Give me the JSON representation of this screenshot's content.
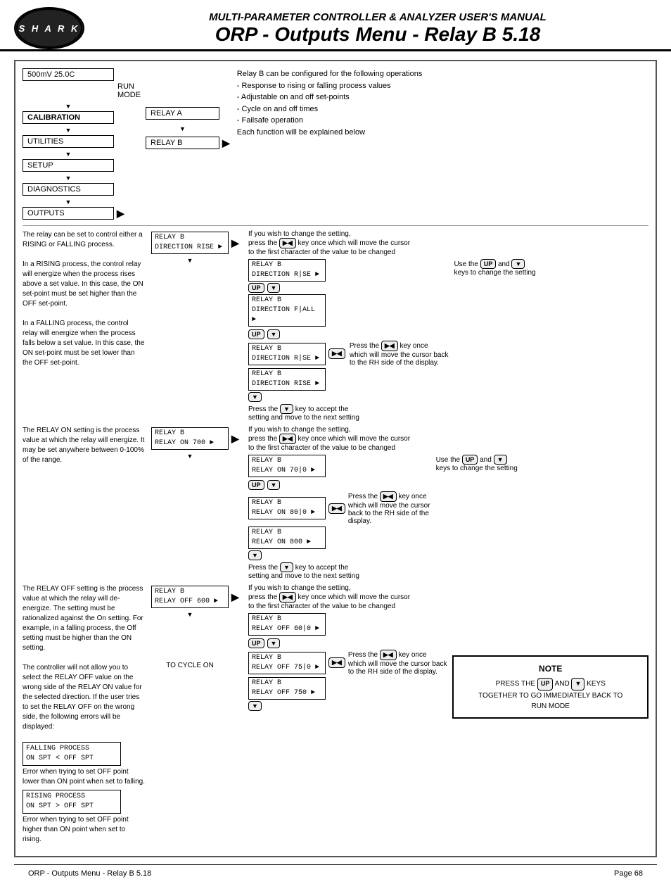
{
  "header": {
    "logo": "S H A R K",
    "title": "MULTI-PARAMETER CONTROLLER & ANALYZER USER'S MANUAL",
    "subtitle": "ORP - Outputs Menu - Relay B 5.18"
  },
  "footer": {
    "left": "ORP - Outputs Menu - Relay B 5.18",
    "right": "Page 68"
  },
  "menu_items": [
    "CALIBRATION",
    "UTILITIES",
    "SETUP",
    "DIAGNOSTICS",
    "OUTPUTS"
  ],
  "run_mode": "RUN MODE",
  "top_display": "500mV  25.0C",
  "relay_a": "RELAY A",
  "relay_b": "RELAY B",
  "intro_text": [
    "Relay B can be configured for the following operations",
    "- Response to rising or falling process values",
    "- Adjustable on and off set-points",
    "- Cycle on and off times",
    "- Failsafe operation",
    "Each function will be explained below"
  ],
  "direction_text": [
    "The relay can be set to control either a RISING or FALLING process.",
    "In a RISING process, the control relay will energize when the process rises above a set value. In this case, the ON set-point must be set higher than the OFF set-point.",
    "In a FALLING process, the control relay will energize when the process falls below a set value. In this case, the ON set-point must be set lower than the OFF set-point."
  ],
  "relay_on_text": "The RELAY ON setting is the process value at which the relay will energize. It may be set anywhere between 0-100% of the range.",
  "relay_off_text": "The RELAY OFF setting is the process value at which the relay will de-energize. The setting must be rationalized against the On setting. For example, in a falling process, the Off setting must be higher than the ON setting.\n\nThe controller will not allow you to select the RELAY OFF value on the wrong side of the RELAY ON value for the selected direction. If the user tries to set the RELAY OFF on the wrong side, the following errors will be displayed:",
  "direction_boxes": [
    {
      "line1": "RELAY B",
      "line2": "DIRECTION RISE"
    },
    {
      "line1": "RELAY B",
      "line2": "DIRECTION FALL"
    },
    {
      "line1": "RELAY B",
      "line2": "DIRECTION RISE"
    }
  ],
  "relay_on_boxes": [
    {
      "line1": "RELAY B",
      "line2": "RELAY ON   700"
    },
    {
      "line1": "RELAY B",
      "line2": "RELAY ON   800"
    }
  ],
  "relay_off_boxes": [
    {
      "line1": "RELAY B",
      "line2": "RELAY OFF  600"
    },
    {
      "line1": "RELAY B",
      "line2": "RELAY OFF  750"
    }
  ],
  "direction_edit_boxes": [
    {
      "line1": "RELAY B",
      "line2": "DIRECTION R|SE"
    },
    {
      "line1": "RELAY B",
      "line2": "DIRECTION F|ALL"
    },
    {
      "line1": "RELAY B",
      "line2": "DIRECTION R|SE"
    }
  ],
  "relay_on_edit_boxes": [
    {
      "line1": "RELAY B",
      "line2": "RELAY ON  70|0"
    },
    {
      "line1": "RELAY B",
      "line2": "RELAY ON  80|0"
    },
    {
      "line1": "RELAY B",
      "line2": "RELAY ON  800"
    }
  ],
  "relay_off_edit_boxes": [
    {
      "line1": "RELAY B",
      "line2": "RELAY OFF 60|0"
    },
    {
      "line1": "RELAY B",
      "line2": "RELAY OFF 75|0"
    },
    {
      "line1": "RELAY B",
      "line2": "RELAY OFF 750"
    }
  ],
  "error_boxes": [
    {
      "line1": "FALLING PROCESS",
      "line2": "ON SPT < OFF SPT"
    },
    {
      "line1": "RISING PROCESS",
      "line2": "ON SPT > OFF SPT"
    }
  ],
  "error_captions": [
    "Error when trying to set OFF point lower than ON point when set to falling.",
    "Error when trying to set OFF point higher than ON point when set to rising."
  ],
  "to_cycle_on": "TO CYCLE ON",
  "note_title": "NOTE",
  "note_text": "PRESS THE",
  "note_keys": "UP AND DOWN KEYS",
  "note_text2": "TOGETHER TO GO IMMEDIATELY BACK TO RUN MODE",
  "change_setting_text1": "If you wish to change the setting,\npress the      key once which will move the cursor\nto the first character of the value to be changed",
  "use_up_down": "Use the      and\nkeys to change the setting",
  "press_left_right1": "Press the      key once\nwhich will move the cursor back\nto the RH side of the display.",
  "press_down_accept": "Press the      key to accept the\nsetting and move to the next setting"
}
